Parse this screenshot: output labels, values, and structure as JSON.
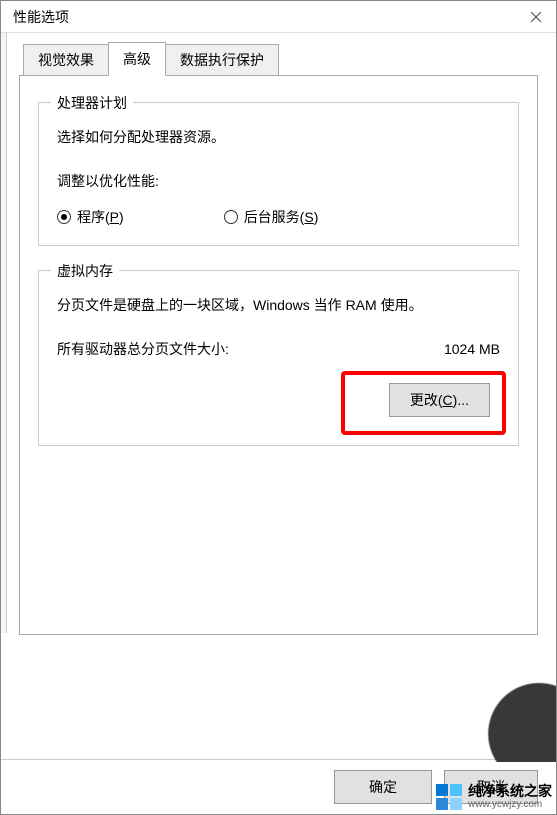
{
  "window": {
    "title": "性能选项"
  },
  "tabs": {
    "items": [
      {
        "label": "视觉效果"
      },
      {
        "label": "高级"
      },
      {
        "label": "数据执行保护"
      }
    ],
    "active_index": 1
  },
  "processor": {
    "group_title": "处理器计划",
    "description": "选择如何分配处理器资源。",
    "adjust_label": "调整以优化性能:",
    "options": {
      "programs": {
        "prefix": "程序(",
        "accel": "P",
        "suffix": ")",
        "selected": true
      },
      "background": {
        "prefix": "后台服务(",
        "accel": "S",
        "suffix": ")",
        "selected": false
      }
    }
  },
  "virtual_memory": {
    "group_title": "虚拟内存",
    "description": "分页文件是硬盘上的一块区域，Windows 当作 RAM 使用。",
    "total_label": "所有驱动器总分页文件大小:",
    "total_value": "1024 MB",
    "change_button": {
      "prefix": "更改(",
      "accel": "C",
      "suffix": ")..."
    }
  },
  "buttons": {
    "ok": "确定",
    "cancel": "取消"
  },
  "watermark": {
    "line1": "纯净系统之家",
    "line2": "www.ycwjzy.com"
  }
}
